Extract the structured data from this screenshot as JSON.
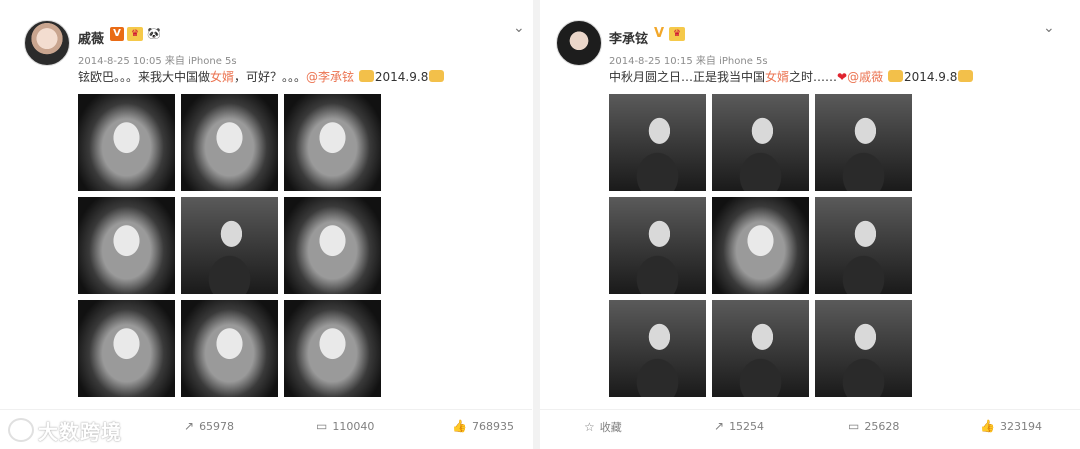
{
  "left_post": {
    "author": "戚薇",
    "meta": "2014-8-25 10:05 来自 iPhone 5s",
    "text_pre": "铉欧巴。。。来我大中国做",
    "text_hl": "女婿",
    "text_mid": "，可好？。。。",
    "mention": "@李承铉",
    "date_tag": "2014.9.8",
    "photos": 9,
    "actions": {
      "repost": "65978",
      "comment": "110040",
      "like": "768935"
    }
  },
  "right_post": {
    "author": "李承铉",
    "meta": "2014-8-25 10:15 来自 iPhone 5s",
    "text_pre": "中秋月圆之日…正是我当中国",
    "text_hl": "女婿",
    "text_mid": "之时……",
    "mention": "@戚薇",
    "date_tag": "2014.9.8",
    "photos": 9,
    "actions": {
      "favorite": "收藏",
      "repost": "15254",
      "comment": "25628",
      "like": "323194"
    }
  },
  "icons": {
    "chevron": "chevron-down-icon",
    "repost": "repost-icon",
    "comment": "comment-icon",
    "like": "like-icon",
    "favorite": "star-icon"
  },
  "watermark": "大数跨境",
  "colors": {
    "highlight": "#eb7350",
    "badge": "#e96b15",
    "meta": "#8c8c8c"
  }
}
